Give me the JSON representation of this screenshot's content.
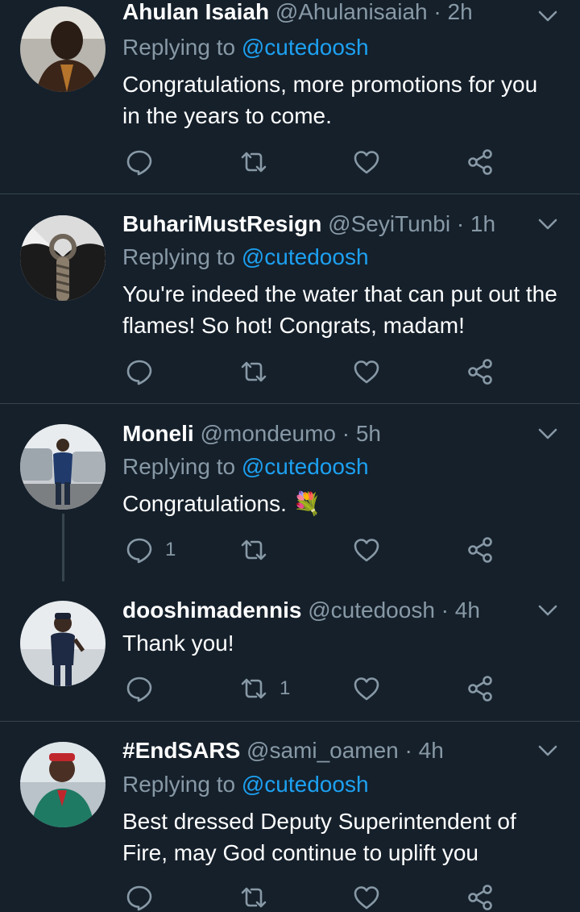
{
  "colors": {
    "background": "#15202b",
    "divider": "#38444d",
    "muted": "#8899a6",
    "link": "#1da1f2",
    "text": "#ffffff"
  },
  "icons": {
    "reply": "reply-icon",
    "retweet": "retweet-icon",
    "like": "heart-icon",
    "share": "share-icon",
    "more": "chevron-down-icon"
  },
  "tweets": [
    {
      "name": "Ahulan Isaiah",
      "handle": "@Ahulanisaiah",
      "time": "· 2h",
      "replying_prefix": "Replying to ",
      "replying_to": "@cutedoosh",
      "text": "Congratulations, more promotions for you in the years to come.",
      "reply_count": "",
      "retweet_count": "",
      "like_count": ""
    },
    {
      "name": "BuhariMustResign",
      "handle": "@SeyiTunbi",
      "time": "· 1h",
      "replying_prefix": "Replying to ",
      "replying_to": "@cutedoosh",
      "text": "You're indeed the water that can put out the flames! So hot! Congrats, madam!",
      "reply_count": "",
      "retweet_count": "",
      "like_count": ""
    },
    {
      "name": "Moneli",
      "handle": "@mondeumo",
      "time": "· 5h",
      "replying_prefix": "Replying to ",
      "replying_to": "@cutedoosh",
      "text": "Congratulations. 💐",
      "reply_count": "1",
      "retweet_count": "",
      "like_count": ""
    },
    {
      "name": "dooshimadennis",
      "handle": "@cutedoosh",
      "time": "· 4h",
      "text": "Thank you!",
      "reply_count": "",
      "retweet_count": "1",
      "like_count": ""
    },
    {
      "name": "#EndSARS",
      "handle": "@sami_oamen",
      "time": "· 4h",
      "replying_prefix": "Replying to ",
      "replying_to": "@cutedoosh",
      "text": "Best dressed Deputy Superintendent of Fire, may God continue to uplift you",
      "reply_count": "",
      "retweet_count": "",
      "like_count": ""
    }
  ]
}
